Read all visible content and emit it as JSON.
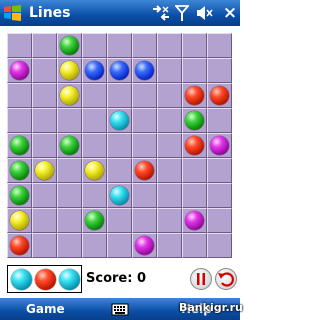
{
  "window": {
    "title": "Lines",
    "close_label": "×"
  },
  "status_icons": [
    "connectivity-icon",
    "signal-icon",
    "volume-icon"
  ],
  "board": {
    "size": 9,
    "rows": [
      [
        "",
        "",
        "green",
        "",
        "",
        "",
        "",
        "",
        ""
      ],
      [
        "purple",
        "",
        "yellow",
        "blue",
        "blue",
        "blue",
        "",
        "",
        ""
      ],
      [
        "",
        "",
        "yellow",
        "",
        "",
        "",
        "",
        "red",
        "red"
      ],
      [
        "",
        "",
        "",
        "",
        "cyan",
        "",
        "",
        "green",
        ""
      ],
      [
        "green",
        "",
        "green",
        "",
        "",
        "",
        "",
        "red",
        "purple"
      ],
      [
        "green",
        "yellow",
        "",
        "yellow",
        "",
        "red",
        "",
        "",
        ""
      ],
      [
        "green",
        "",
        "",
        "",
        "cyan",
        "",
        "",
        "",
        ""
      ],
      [
        "yellow",
        "",
        "",
        "green",
        "",
        "",
        "",
        "purple",
        ""
      ],
      [
        "red",
        "",
        "",
        "",
        "",
        "purple",
        "",
        "",
        ""
      ]
    ]
  },
  "next_balls": [
    "cyan",
    "red",
    "cyan"
  ],
  "score": {
    "text": "Score: 0",
    "value": 0
  },
  "softkeys": {
    "left": "Game",
    "right": "Help"
  },
  "watermark": "Bankigr.ru",
  "colors": {
    "titlebar": "#0b4ea6",
    "cell": "#b3a2d0"
  }
}
